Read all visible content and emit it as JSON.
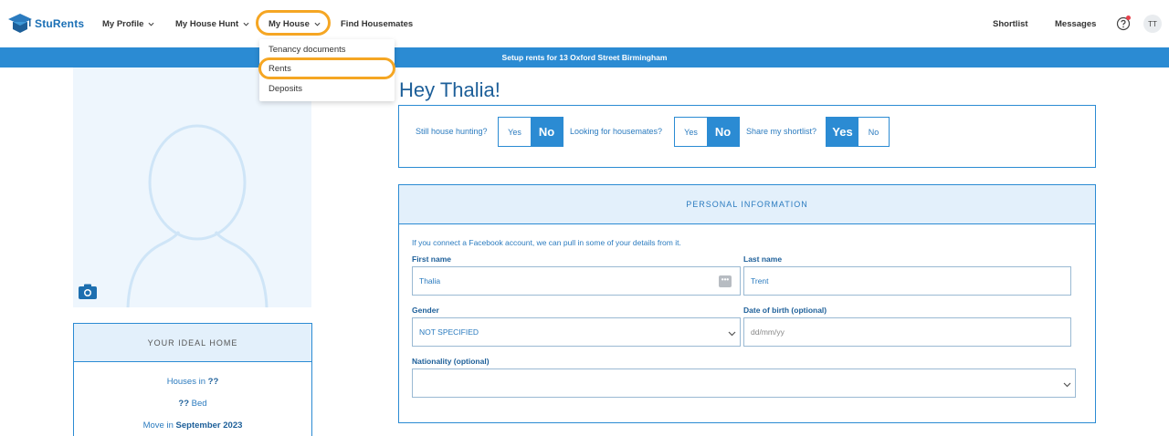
{
  "brand": {
    "name": "StuRents",
    "accent": "#2b8bd3",
    "highlight": "#f5a623"
  },
  "nav": {
    "items": [
      {
        "label": "My Profile",
        "has_chevron": true
      },
      {
        "label": "My House Hunt",
        "has_chevron": true
      },
      {
        "label": "My House",
        "has_chevron": true
      },
      {
        "label": "Find Housemates",
        "has_chevron": false
      }
    ],
    "right": {
      "shortlist": "Shortlist",
      "messages": "Messages",
      "help_icon": "help-circle-icon",
      "avatar_initials": "TT"
    }
  },
  "dropdown": {
    "items": [
      {
        "label": "Tenancy documents"
      },
      {
        "label": "Rents"
      },
      {
        "label": "Deposits"
      }
    ]
  },
  "banner": {
    "text": "Setup rents for 13 Oxford Street Birmingham"
  },
  "profile": {
    "photo_icon": "camera-icon"
  },
  "ideal_home": {
    "title": "YOUR IDEAL HOME",
    "houses_in_prefix": "Houses in ",
    "houses_in_value": "??",
    "bed_value": "??",
    "bed_suffix": " Bed",
    "move_in_prefix": "Move in ",
    "move_in_value": "September 2023"
  },
  "greeting": "Hey Thalia!",
  "status": {
    "house_hunting": {
      "label": "Still house hunting?",
      "yes": "Yes",
      "no": "No",
      "selected": "No"
    },
    "housemates": {
      "label": "Looking for housemates?",
      "yes": "Yes",
      "no": "No",
      "selected": "No"
    },
    "shortlist": {
      "label": "Share my shortlist?",
      "yes": "Yes",
      "no": "No",
      "selected": "Yes"
    }
  },
  "personal_info": {
    "title": "PERSONAL INFORMATION",
    "facebook_note": "If you connect a Facebook account, we can pull in some of your details from it.",
    "first_name_label": "First name",
    "first_name_value": "Thalia",
    "last_name_label": "Last name",
    "last_name_value": "Trent",
    "gender_label": "Gender",
    "gender_value": "NOT SPECIFIED",
    "dob_label": "Date of birth (optional)",
    "dob_placeholder": "dd/mm/yy",
    "nationality_label": "Nationality (optional)",
    "nationality_value": ""
  }
}
